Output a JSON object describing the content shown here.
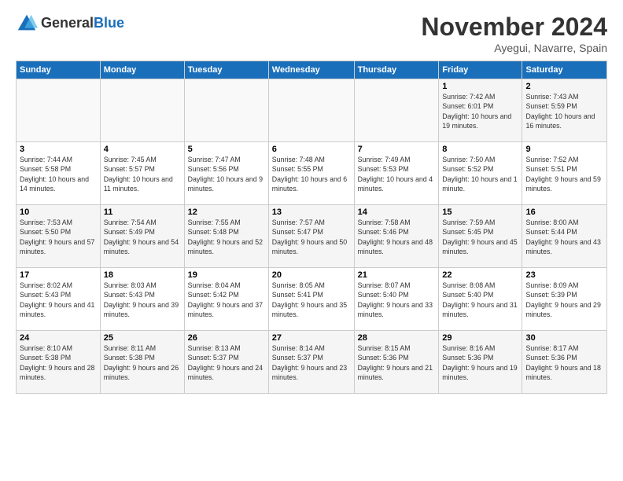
{
  "header": {
    "logo_line1": "General",
    "logo_line2": "Blue",
    "month": "November 2024",
    "location": "Ayegui, Navarre, Spain"
  },
  "weekdays": [
    "Sunday",
    "Monday",
    "Tuesday",
    "Wednesday",
    "Thursday",
    "Friday",
    "Saturday"
  ],
  "weeks": [
    [
      {
        "day": "",
        "info": ""
      },
      {
        "day": "",
        "info": ""
      },
      {
        "day": "",
        "info": ""
      },
      {
        "day": "",
        "info": ""
      },
      {
        "day": "",
        "info": ""
      },
      {
        "day": "1",
        "info": "Sunrise: 7:42 AM\nSunset: 6:01 PM\nDaylight: 10 hours and 19 minutes."
      },
      {
        "day": "2",
        "info": "Sunrise: 7:43 AM\nSunset: 5:59 PM\nDaylight: 10 hours and 16 minutes."
      }
    ],
    [
      {
        "day": "3",
        "info": "Sunrise: 7:44 AM\nSunset: 5:58 PM\nDaylight: 10 hours and 14 minutes."
      },
      {
        "day": "4",
        "info": "Sunrise: 7:45 AM\nSunset: 5:57 PM\nDaylight: 10 hours and 11 minutes."
      },
      {
        "day": "5",
        "info": "Sunrise: 7:47 AM\nSunset: 5:56 PM\nDaylight: 10 hours and 9 minutes."
      },
      {
        "day": "6",
        "info": "Sunrise: 7:48 AM\nSunset: 5:55 PM\nDaylight: 10 hours and 6 minutes."
      },
      {
        "day": "7",
        "info": "Sunrise: 7:49 AM\nSunset: 5:53 PM\nDaylight: 10 hours and 4 minutes."
      },
      {
        "day": "8",
        "info": "Sunrise: 7:50 AM\nSunset: 5:52 PM\nDaylight: 10 hours and 1 minute."
      },
      {
        "day": "9",
        "info": "Sunrise: 7:52 AM\nSunset: 5:51 PM\nDaylight: 9 hours and 59 minutes."
      }
    ],
    [
      {
        "day": "10",
        "info": "Sunrise: 7:53 AM\nSunset: 5:50 PM\nDaylight: 9 hours and 57 minutes."
      },
      {
        "day": "11",
        "info": "Sunrise: 7:54 AM\nSunset: 5:49 PM\nDaylight: 9 hours and 54 minutes."
      },
      {
        "day": "12",
        "info": "Sunrise: 7:55 AM\nSunset: 5:48 PM\nDaylight: 9 hours and 52 minutes."
      },
      {
        "day": "13",
        "info": "Sunrise: 7:57 AM\nSunset: 5:47 PM\nDaylight: 9 hours and 50 minutes."
      },
      {
        "day": "14",
        "info": "Sunrise: 7:58 AM\nSunset: 5:46 PM\nDaylight: 9 hours and 48 minutes."
      },
      {
        "day": "15",
        "info": "Sunrise: 7:59 AM\nSunset: 5:45 PM\nDaylight: 9 hours and 45 minutes."
      },
      {
        "day": "16",
        "info": "Sunrise: 8:00 AM\nSunset: 5:44 PM\nDaylight: 9 hours and 43 minutes."
      }
    ],
    [
      {
        "day": "17",
        "info": "Sunrise: 8:02 AM\nSunset: 5:43 PM\nDaylight: 9 hours and 41 minutes."
      },
      {
        "day": "18",
        "info": "Sunrise: 8:03 AM\nSunset: 5:43 PM\nDaylight: 9 hours and 39 minutes."
      },
      {
        "day": "19",
        "info": "Sunrise: 8:04 AM\nSunset: 5:42 PM\nDaylight: 9 hours and 37 minutes."
      },
      {
        "day": "20",
        "info": "Sunrise: 8:05 AM\nSunset: 5:41 PM\nDaylight: 9 hours and 35 minutes."
      },
      {
        "day": "21",
        "info": "Sunrise: 8:07 AM\nSunset: 5:40 PM\nDaylight: 9 hours and 33 minutes."
      },
      {
        "day": "22",
        "info": "Sunrise: 8:08 AM\nSunset: 5:40 PM\nDaylight: 9 hours and 31 minutes."
      },
      {
        "day": "23",
        "info": "Sunrise: 8:09 AM\nSunset: 5:39 PM\nDaylight: 9 hours and 29 minutes."
      }
    ],
    [
      {
        "day": "24",
        "info": "Sunrise: 8:10 AM\nSunset: 5:38 PM\nDaylight: 9 hours and 28 minutes."
      },
      {
        "day": "25",
        "info": "Sunrise: 8:11 AM\nSunset: 5:38 PM\nDaylight: 9 hours and 26 minutes."
      },
      {
        "day": "26",
        "info": "Sunrise: 8:13 AM\nSunset: 5:37 PM\nDaylight: 9 hours and 24 minutes."
      },
      {
        "day": "27",
        "info": "Sunrise: 8:14 AM\nSunset: 5:37 PM\nDaylight: 9 hours and 23 minutes."
      },
      {
        "day": "28",
        "info": "Sunrise: 8:15 AM\nSunset: 5:36 PM\nDaylight: 9 hours and 21 minutes."
      },
      {
        "day": "29",
        "info": "Sunrise: 8:16 AM\nSunset: 5:36 PM\nDaylight: 9 hours and 19 minutes."
      },
      {
        "day": "30",
        "info": "Sunrise: 8:17 AM\nSunset: 5:36 PM\nDaylight: 9 hours and 18 minutes."
      }
    ]
  ]
}
